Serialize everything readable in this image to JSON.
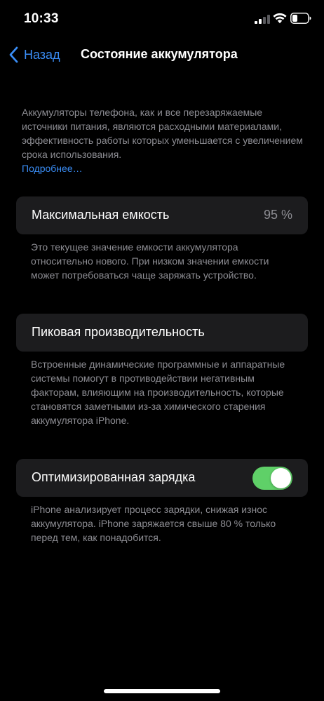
{
  "status_bar": {
    "time": "10:33"
  },
  "nav": {
    "back_label": "Назад",
    "title": "Состояние аккумулятора"
  },
  "intro": {
    "text": "Аккумуляторы телефона, как и все перезаряжаемые источники питания, являются расходными материалами, эффективность работы которых уменьшается с увеличением срока использования.",
    "link": "Подробнее…"
  },
  "max_capacity": {
    "label": "Максимальная емкость",
    "value": "95 %",
    "footnote": "Это текущее значение емкости аккумулятора относительно нового. При низком значении емкости может потребоваться чаще заряжать устройство."
  },
  "peak_performance": {
    "label": "Пиковая производительность",
    "footnote": "Встроенные динамические программные и аппаратные системы помогут в противодействии негативным факторам, влияющим на производительность, которые становятся заметными из-за химического старения аккумулятора iPhone."
  },
  "optimized_charging": {
    "label": "Оптимизированная зарядка",
    "enabled": true,
    "footnote": "iPhone анализирует процесс зарядки, снижая износ аккумулятора. iPhone заряжается свыше 80 % только перед тем, как понадобится."
  },
  "colors": {
    "background": "#000000",
    "card": "#1c1c1e",
    "accent": "#3a8df5",
    "secondary_text": "#8d8d93",
    "toggle_on": "#5fd068"
  },
  "icons": {
    "signal": "cellular-signal-icon",
    "wifi": "wifi-icon",
    "battery": "battery-icon",
    "back": "chevron-left-icon"
  }
}
